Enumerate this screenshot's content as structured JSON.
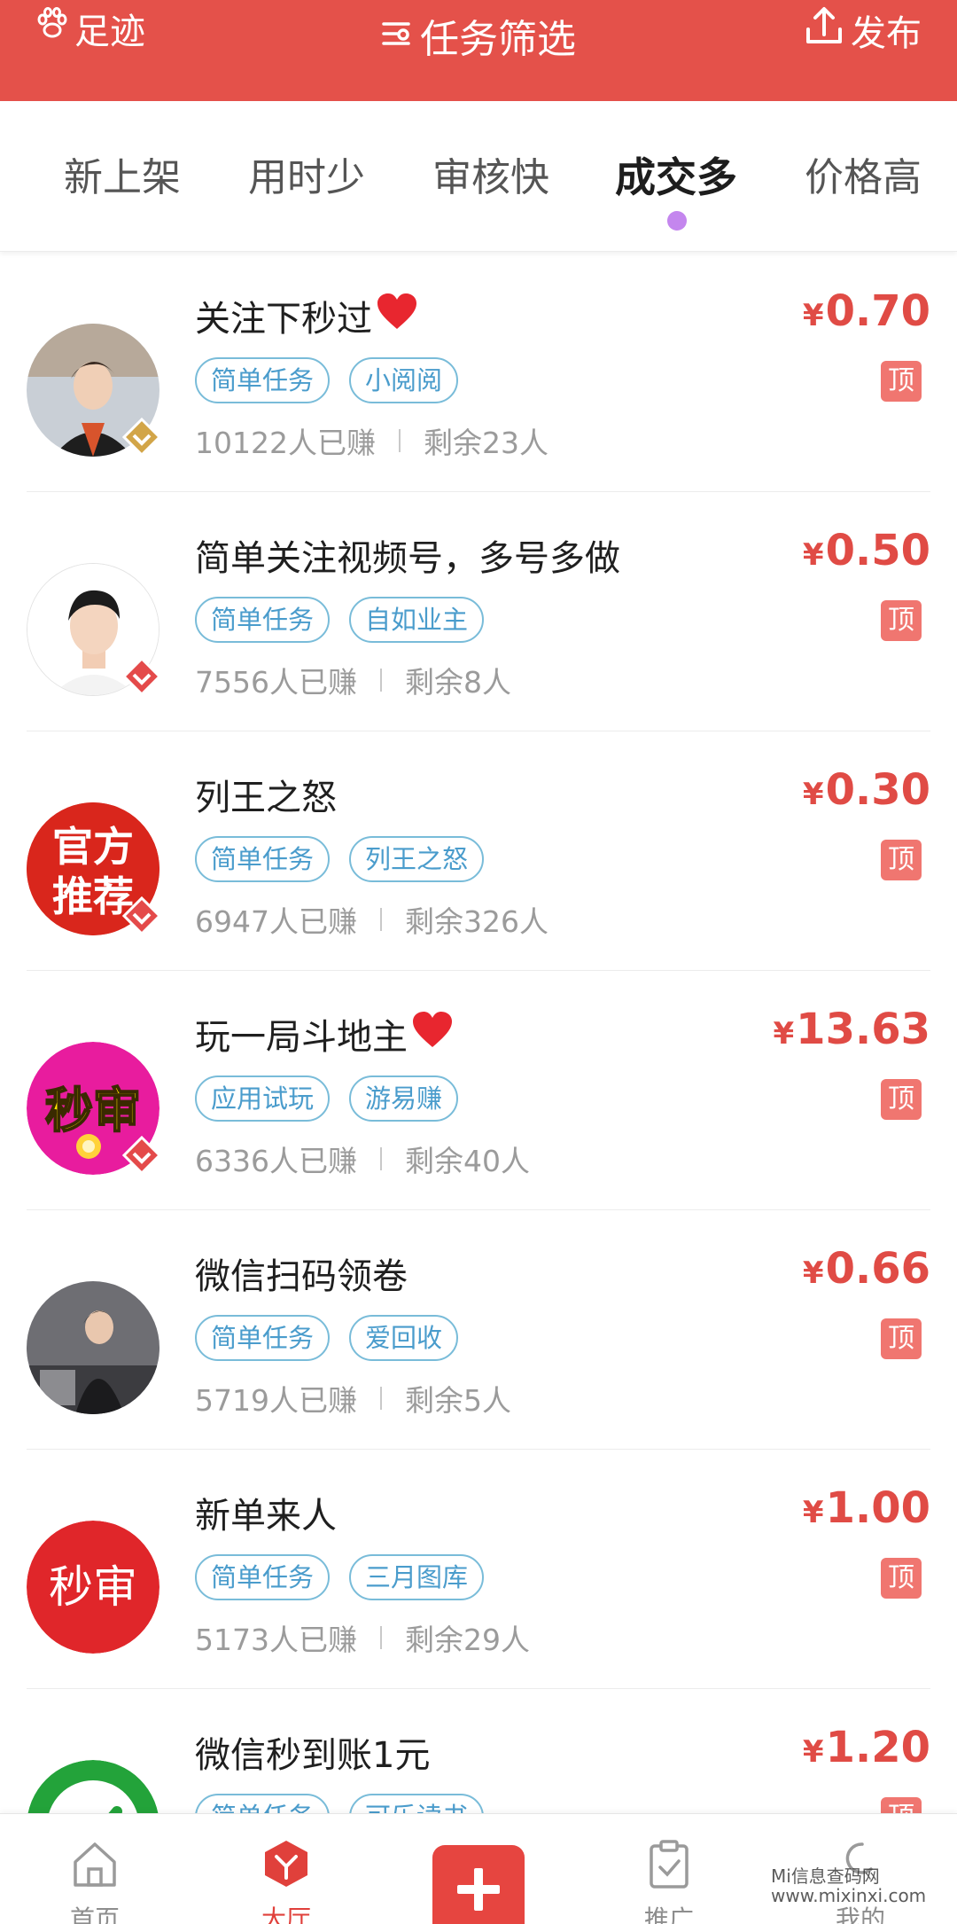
{
  "header": {
    "left_label": "足迹",
    "title": "任务筛选",
    "right_label": "发布",
    "bg_color": "#e4514a"
  },
  "tabs": [
    {
      "label": "新上架",
      "active": false
    },
    {
      "label": "用时少",
      "active": false
    },
    {
      "label": "审核快",
      "active": false
    },
    {
      "label": "成交多",
      "active": true
    },
    {
      "label": "价格高",
      "active": false
    }
  ],
  "tasks": [
    {
      "title": "关注下秒过",
      "heart": true,
      "tags": [
        "简单任务",
        "小阅阅"
      ],
      "earned": "10122人已赚",
      "remaining": "剩余23人",
      "price": "0.70",
      "pin": "顶",
      "avatar_text": ""
    },
    {
      "title": "简单关注视频号，多号多做",
      "heart": false,
      "tags": [
        "简单任务",
        "自如业主"
      ],
      "earned": "7556人已赚",
      "remaining": "剩余8人",
      "price": "0.50",
      "pin": "顶",
      "avatar_text": ""
    },
    {
      "title": "列王之怒",
      "heart": false,
      "tags": [
        "简单任务",
        "列王之怒"
      ],
      "earned": "6947人已赚",
      "remaining": "剩余326人",
      "price": "0.30",
      "pin": "顶",
      "avatar_text": "官方推荐"
    },
    {
      "title": "玩一局斗地主",
      "heart": true,
      "tags": [
        "应用试玩",
        "游易赚"
      ],
      "earned": "6336人已赚",
      "remaining": "剩余40人",
      "price": "13.63",
      "pin": "顶",
      "avatar_text": "秒审"
    },
    {
      "title": "微信扫码领卷",
      "heart": false,
      "tags": [
        "简单任务",
        "爱回收"
      ],
      "earned": "5719人已赚",
      "remaining": "剩余5人",
      "price": "0.66",
      "pin": "顶",
      "avatar_text": ""
    },
    {
      "title": "新单来人",
      "heart": false,
      "tags": [
        "简单任务",
        "三月图库"
      ],
      "earned": "5173人已赚",
      "remaining": "剩余29人",
      "price": "1.00",
      "pin": "顶",
      "avatar_text": "秒审"
    },
    {
      "title": "微信秒到账1元",
      "heart": false,
      "tags": [
        "简单任务",
        "可乐读书"
      ],
      "earned": "",
      "remaining": "",
      "price": "1.20",
      "pin": "顶",
      "avatar_text": ""
    }
  ],
  "currency_symbol": "¥",
  "bottom_nav": [
    {
      "label": "首页",
      "icon": "home-icon",
      "active": false
    },
    {
      "label": "大厅",
      "icon": "hall-icon",
      "active": true
    },
    {
      "label": "",
      "icon": "plus-icon",
      "active": false
    },
    {
      "label": "推广",
      "icon": "clipboard-icon",
      "active": false
    },
    {
      "label": "我的",
      "icon": "profile-icon",
      "active": false
    }
  ],
  "watermark": {
    "line1": "Mi信息查码网",
    "line2": "www.mixinxi.com"
  }
}
